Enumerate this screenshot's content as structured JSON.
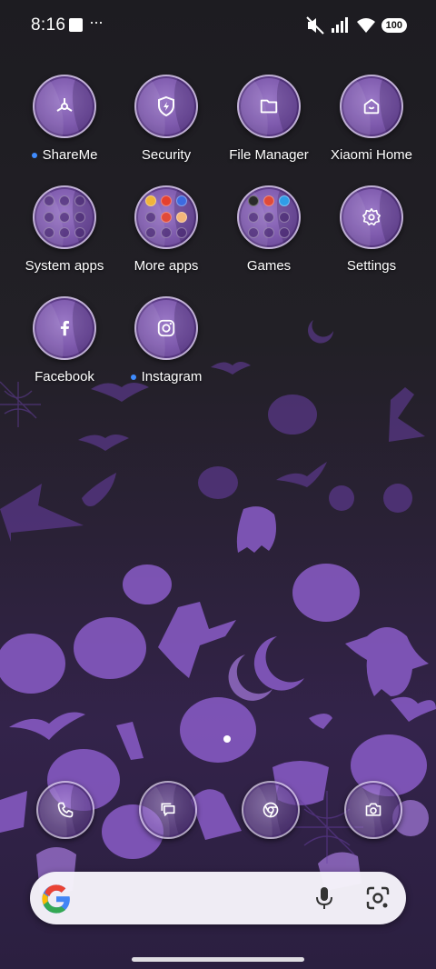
{
  "status_bar": {
    "time": "8:16",
    "more": "···",
    "battery": "100",
    "icons": [
      "notification-square-icon",
      "mute-icon",
      "signal-icon",
      "wifi-icon",
      "battery-icon"
    ]
  },
  "apps": {
    "shareme": {
      "label": "ShareMe",
      "icon": "shareme-icon"
    },
    "security": {
      "label": "Security",
      "icon": "shield-icon"
    },
    "file_manager": {
      "label": "File Manager",
      "icon": "folder-icon"
    },
    "xiaomi_home": {
      "label": "Xiaomi Home",
      "icon": "home-icon"
    },
    "system_apps": {
      "label": "System apps",
      "icon": "folder-grid-icon"
    },
    "more_apps": {
      "label": "More apps",
      "icon": "folder-grid-icon"
    },
    "games": {
      "label": "Games",
      "icon": "folder-grid-icon"
    },
    "settings": {
      "label": "Settings",
      "icon": "gear-icon"
    },
    "facebook": {
      "label": "Facebook",
      "icon": "facebook-icon"
    },
    "instagram": {
      "label": "Instagram",
      "icon": "instagram-icon"
    }
  },
  "dock": [
    "phone-icon",
    "messages-icon",
    "chrome-icon",
    "camera-icon"
  ],
  "search_bar": {
    "icons": [
      "google-icon",
      "mic-icon",
      "lens-icon"
    ]
  },
  "colors": {
    "accent_purple": "#7d59ac",
    "new_badge": "#3f8cff"
  }
}
